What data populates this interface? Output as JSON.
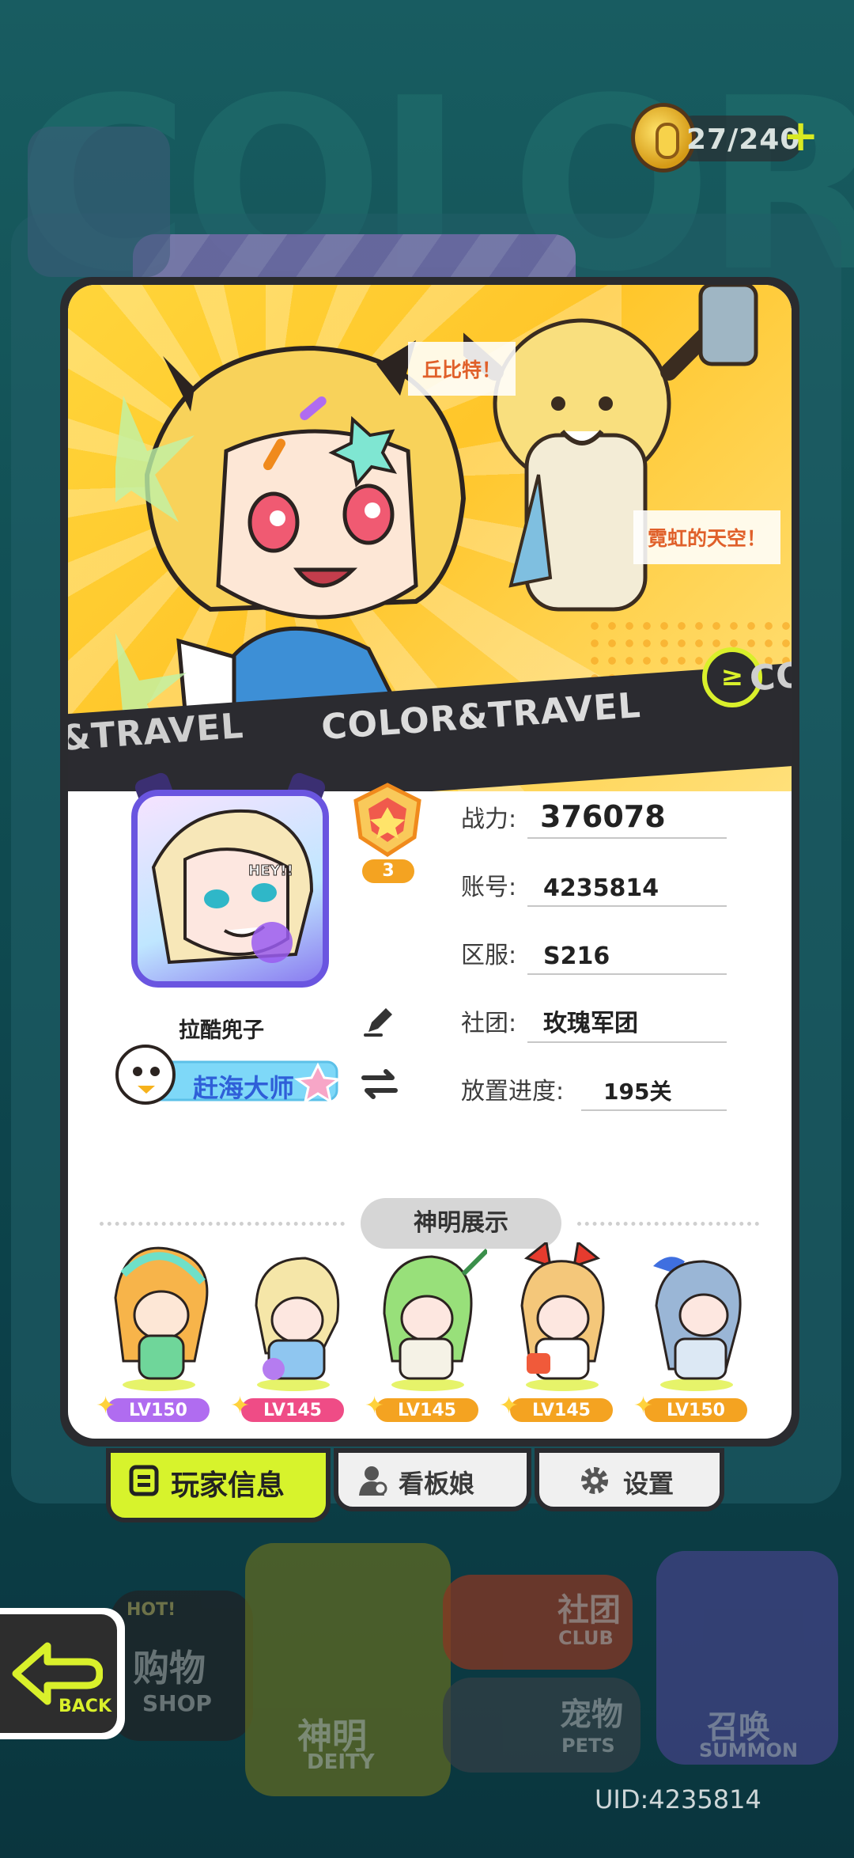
{
  "currency": {
    "label": "27/240",
    "plus": "+"
  },
  "banner": {
    "speech_1": "丘比特！",
    "speech_2": "霓虹的天空！",
    "ribbon_main": "COLOR&TRAVEL",
    "ribbon_left": "&TRAVEL",
    "ribbon_right": "CO",
    "logo_glyph": "≥"
  },
  "profile": {
    "name": "拉酷兜子",
    "rank_level": "3",
    "title_badge": "赶海大师",
    "avatar_tag": "HEY!!"
  },
  "stats": [
    {
      "label": "战力:",
      "value": "376078"
    },
    {
      "label": "账号:",
      "value": "4235814"
    },
    {
      "label": "区服:",
      "value": "S216"
    },
    {
      "label": "社团:",
      "value": "玫瑰军团"
    },
    {
      "label": "放置进度:",
      "value": "195关"
    }
  ],
  "deity": {
    "header": "神明展示",
    "items": [
      {
        "level": "LV150",
        "badge_color": "#b06cf0"
      },
      {
        "level": "LV145",
        "badge_color": "#ef4c86"
      },
      {
        "level": "LV145",
        "badge_color": "#f4a321"
      },
      {
        "level": "LV145",
        "badge_color": "#f4a321"
      },
      {
        "level": "LV150",
        "badge_color": "#f4a321"
      }
    ]
  },
  "tabs": [
    {
      "label": "玩家信息",
      "active": true
    },
    {
      "label": "看板娘",
      "active": false
    },
    {
      "label": "设置",
      "active": false
    }
  ],
  "menu": {
    "shop": "购物",
    "shop_en": "SHOP",
    "shop_hot": "HOT!",
    "deity": "神明",
    "deity_en": "DEITY",
    "club": "社团",
    "club_en": "CLUB",
    "pets": "宠物",
    "pets_en": "PETS",
    "summon": "召唤",
    "summon_en": "SUMMON",
    "back": "BACK"
  },
  "footer": {
    "uid": "UID:4235814"
  },
  "colors": {
    "accent": "#d9f02b",
    "card_border": "#2a2b2f",
    "rank_badge": "#f4a321"
  }
}
